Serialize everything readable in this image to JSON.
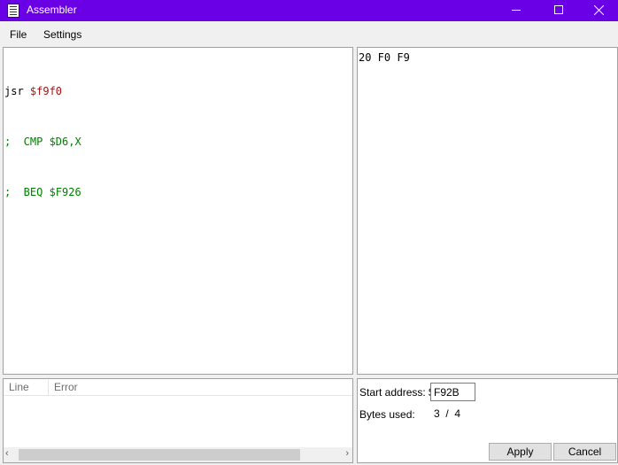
{
  "window": {
    "title": "Assembler",
    "controls": {
      "minimize": "minimize",
      "maximize": "maximize",
      "close": "close"
    }
  },
  "menu": {
    "items": [
      {
        "label": "File"
      },
      {
        "label": "Settings"
      }
    ]
  },
  "source": {
    "lines": [
      {
        "mnemonic": "jsr ",
        "operand": "$f9f0",
        "comment": ""
      },
      {
        "mnemonic": "",
        "operand": "",
        "comment": ";  CMP $D6,X"
      },
      {
        "mnemonic": "",
        "operand": "",
        "comment": ";  BEQ $F926"
      }
    ]
  },
  "output": {
    "bytes": "20 F0 F9"
  },
  "errors": {
    "columns": [
      "Line",
      "Error"
    ],
    "rows": [],
    "scroll_left": "‹",
    "scroll_right": "›"
  },
  "controls": {
    "start_address_label": "Start address: $",
    "start_address_value": "F92B",
    "bytes_used_label": "Bytes used:",
    "bytes_used_value": "3  /  4",
    "apply_label": "Apply",
    "cancel_label": "Cancel"
  },
  "colors": {
    "titlebar": "#6a00e6",
    "operand": "#a31515",
    "comment": "#008000"
  }
}
